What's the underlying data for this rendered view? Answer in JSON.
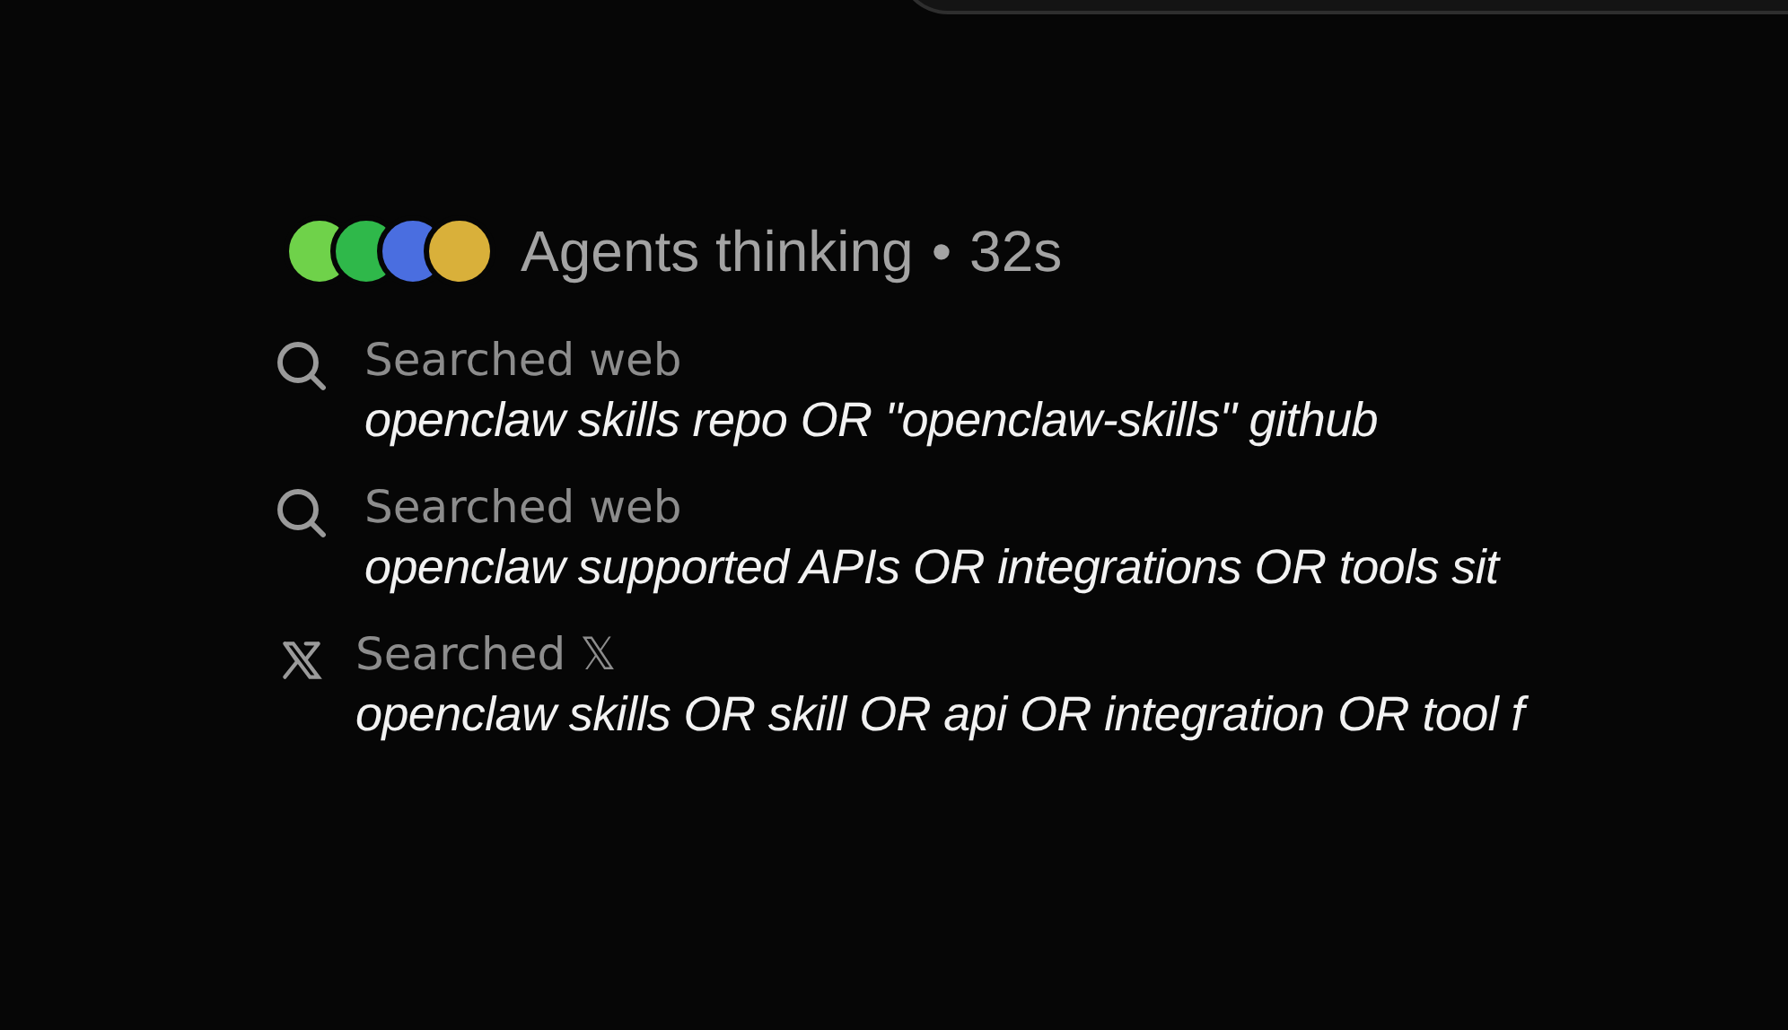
{
  "status": {
    "agents": [
      {
        "color": "#6fd24a"
      },
      {
        "color": "#2fb84a"
      },
      {
        "color": "#4a6ee0"
      },
      {
        "color": "#d9b03a"
      }
    ],
    "label": "Agents thinking",
    "separator": "•",
    "elapsed": "32s"
  },
  "steps": [
    {
      "kind": "web",
      "label": "Searched web",
      "query": "openclaw skills repo OR \"openclaw-skills\" github"
    },
    {
      "kind": "web",
      "label": "Searched web",
      "query": "openclaw supported APIs OR integrations OR tools sit"
    },
    {
      "kind": "x",
      "label": "Searched 𝕏",
      "query": "openclaw skills OR skill OR api OR integration OR tool f"
    }
  ]
}
